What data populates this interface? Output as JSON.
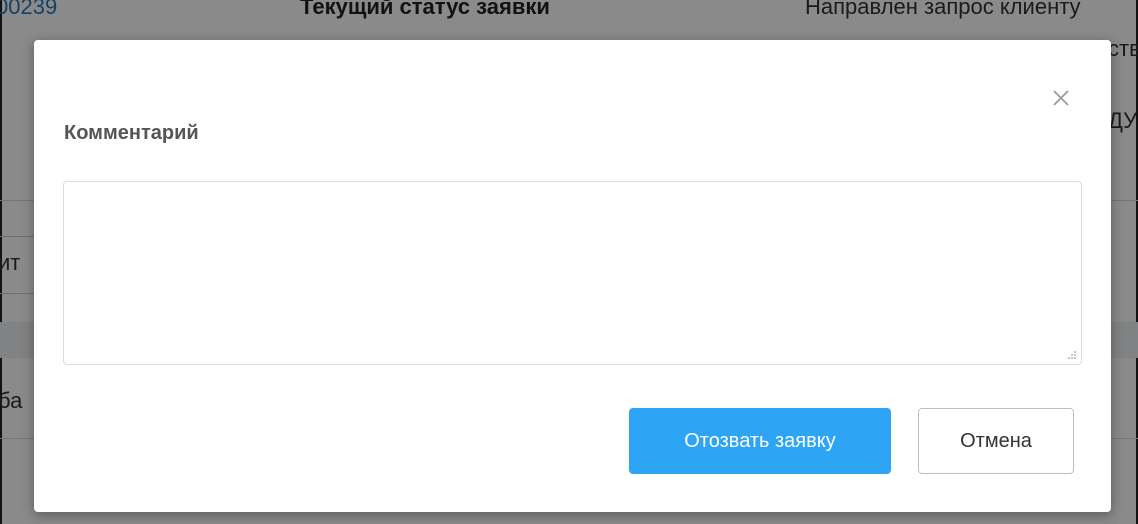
{
  "background": {
    "request_id_fragment": "00239",
    "status_heading": "Текущий статус заявки",
    "status_text_line1": "Направлен запрос клиенту",
    "status_text_line2_fragment": "ство",
    "status_text_line3_fragment": "ДУ",
    "left_fragment_1": "ит",
    "left_fragment_2": "ба"
  },
  "modal": {
    "close_icon": "close-icon",
    "comment_label": "Комментарий",
    "comment_value": "",
    "comment_placeholder": "",
    "primary_button_label": "Отозвать заявку",
    "cancel_button_label": "Отмена",
    "colors": {
      "primary_button": "#2ea4f5",
      "overlay": "rgba(0,0,0,0.46)"
    }
  }
}
